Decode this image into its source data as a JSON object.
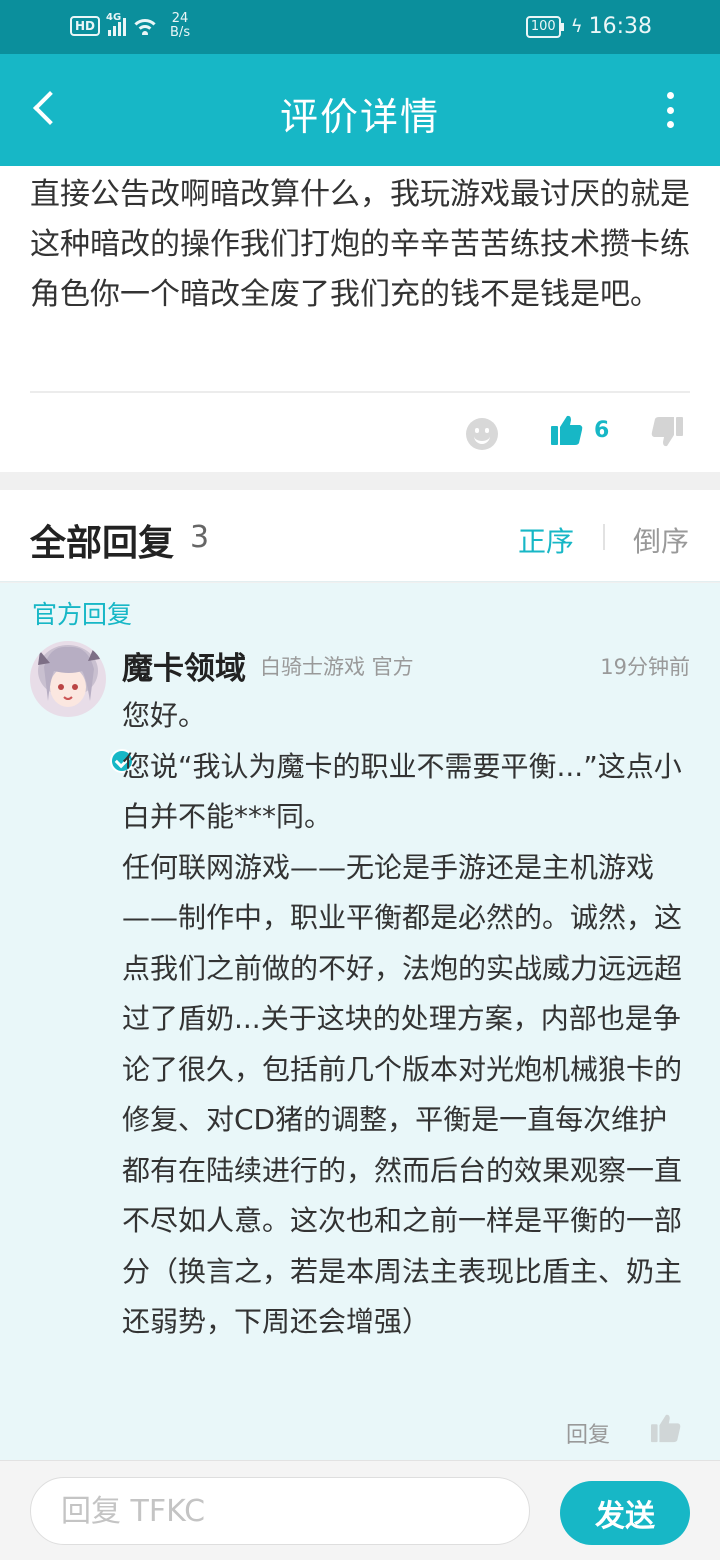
{
  "status_bar": {
    "hd": "HD",
    "network": "4G",
    "speed_value": "24",
    "speed_unit": "B/s",
    "battery": "100",
    "time": "16:38",
    "icons": [
      "hd-icon",
      "signal-icon",
      "wifi-icon",
      "battery-icon",
      "charging-icon"
    ]
  },
  "app_bar": {
    "title": "评价详情",
    "back_icon": "back-arrow-icon",
    "more_icon": "more-vertical-icon"
  },
  "review": {
    "text": "直接公告改啊暗改算什么，我玩游戏最讨厌的就是这种暗改的操作我们打炮的辛辛苦苦练技术攒卡练角色你一个暗改全废了我们充的钱不是钱是吧。",
    "like_count": "6",
    "icons": [
      "emoji-icon",
      "thumbs-up-icon",
      "thumbs-down-icon"
    ]
  },
  "replies_header": {
    "label": "全部回复",
    "count": "3",
    "sort_asc": "正序",
    "sort_desc": "倒序",
    "active_sort": "正序"
  },
  "official_reply": {
    "tag": "官方回复",
    "name": "魔卡领域",
    "meta": "白骑士游戏 官方",
    "time": "19分钟前",
    "body_lines": [
      "您好。",
      "您说“我认为魔卡的职业不需要平衡...”这点小白并不能***同。",
      "任何联网游戏——无论是手游还是主机游戏——制作中，职业平衡都是必然的。诚然，这点我们之前做的不好，法炮的实战威力远远超过了盾奶...关于这块的处理方案，内部也是争论了很久，包括前几个版本对光炮机械狼卡的修复、对CD猪的调整，平衡是一直每次维护都有在陆续进行的，然而后台的效果观察一直不尽如人意。这次也和之前一样是平衡的一部分（换言之，若是本周法主表现比盾主、奶主还弱势，下周还会增强）"
    ],
    "reply_label": "回复",
    "icons": [
      "avatar",
      "verified-icon",
      "thumbs-up-icon"
    ]
  },
  "input_bar": {
    "placeholder": "回复 TFKC",
    "send_label": "发送"
  },
  "colors": {
    "status_bar": "#0b8f9c",
    "accent": "#17b7c6",
    "official_bg": "#e9f7f9",
    "page_bg": "#f0f0f0"
  }
}
